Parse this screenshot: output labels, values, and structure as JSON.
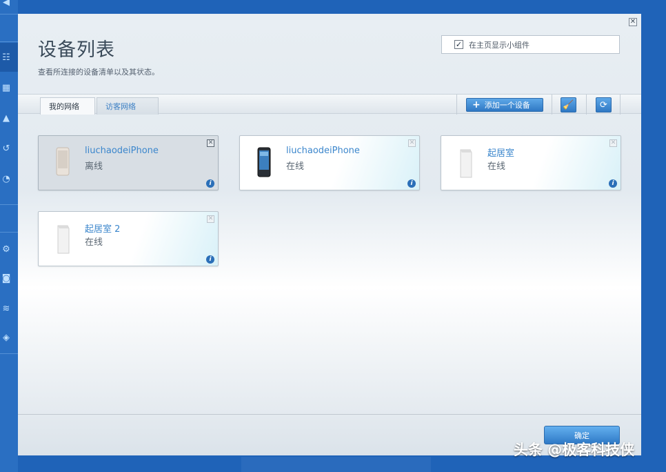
{
  "dialog": {
    "title": "设备列表",
    "subtitle": "查看所连接的设备清单以及其状态。",
    "close_icon": "close-icon",
    "show_widget": {
      "label": "在主页显示小组件",
      "checked": true
    }
  },
  "tabs": [
    {
      "label": "我的网络",
      "active": true
    },
    {
      "label": "访客网络",
      "active": false
    }
  ],
  "toolbar": {
    "add_device_label": "添加一个设备",
    "clean_icon": "broom-icon",
    "refresh_icon": "refresh-icon"
  },
  "devices": [
    {
      "name": "liuchaodeiPhone",
      "status": "离线",
      "type": "phone",
      "online": false
    },
    {
      "name": "liuchaodeiPhone",
      "status": "在线",
      "type": "phone",
      "online": true
    },
    {
      "name": "起居室",
      "status": "在线",
      "type": "node",
      "online": true
    },
    {
      "name": "起居室 2",
      "status": "在线",
      "type": "node",
      "online": true
    }
  ],
  "footer": {
    "ok_label": "确定"
  },
  "watermark": "头条 @极客科技侠",
  "colors": {
    "accent": "#2f78c4",
    "link": "#3b86cc",
    "background": "#1f63b8"
  }
}
